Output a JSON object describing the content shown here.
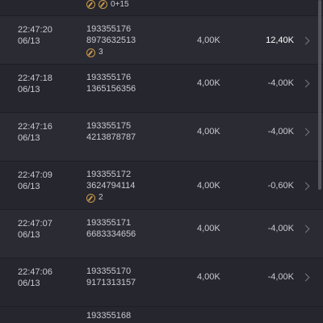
{
  "top_partial": {
    "badge_a_text": "",
    "badge_b_text": "0+15"
  },
  "rows": [
    {
      "time": "22:47:20",
      "date": "06/13",
      "id_line1": "193355176",
      "id_line2": "8973632513",
      "badge": "3",
      "amount": "4,00K",
      "result": "12,40K"
    },
    {
      "time": "22:47:18",
      "date": "06/13",
      "id_line1": "193355176",
      "id_line2": "1365156356",
      "badge": null,
      "amount": "4,00K",
      "result": "-4,00K"
    },
    {
      "time": "22:47:16",
      "date": "06/13",
      "id_line1": "193355175",
      "id_line2": "4213878787",
      "badge": null,
      "amount": "4,00K",
      "result": "-4,00K"
    },
    {
      "time": "22:47:09",
      "date": "06/13",
      "id_line1": "193355172",
      "id_line2": "3624794114",
      "badge": "2",
      "amount": "4,00K",
      "result": "-0,60K"
    },
    {
      "time": "22:47:07",
      "date": "06/13",
      "id_line1": "193355171",
      "id_line2": "6683334656",
      "badge": null,
      "amount": "4,00K",
      "result": "-4,00K"
    },
    {
      "time": "22:47:06",
      "date": "06/13",
      "id_line1": "193355170",
      "id_line2": "9171313157",
      "badge": null,
      "amount": "4,00K",
      "result": "-4,00K"
    }
  ],
  "bottom_partial": {
    "id_line1": "193355168"
  },
  "icons": {
    "coin": "coin-icon",
    "chevron": "chevron-right-icon",
    "refresh": "refresh-icon"
  },
  "colors": {
    "background": "#26262e",
    "row_alt": "#2b2b34",
    "text": "#c9c9d0",
    "positive": "#ffffff",
    "coin": "#c99a4a"
  }
}
